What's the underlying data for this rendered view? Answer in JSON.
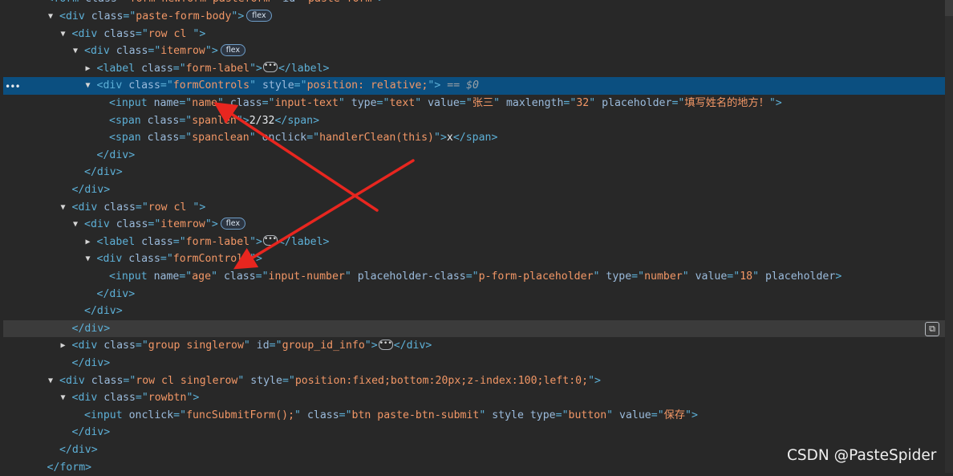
{
  "elements_tree": {
    "lines": [
      {
        "depth": 3,
        "open_tag": "form",
        "attrs": [
          [
            "class",
            "form newform pasteform"
          ],
          [
            "id",
            "paste-form"
          ]
        ],
        "tail": ">",
        "partial": true
      },
      {
        "depth": 4,
        "toggle": "open",
        "open_tag": "div",
        "attrs": [
          [
            "class",
            "paste-form-body"
          ]
        ],
        "tail": ">",
        "badge": "flex"
      },
      {
        "depth": 5,
        "toggle": "open",
        "open_tag": "div",
        "attrs": [
          [
            "class",
            "row cl "
          ]
        ],
        "tail": ">"
      },
      {
        "depth": 6,
        "toggle": "open",
        "open_tag": "div",
        "attrs": [
          [
            "class",
            "itemrow"
          ]
        ],
        "tail": ">",
        "badge": "flex"
      },
      {
        "depth": 7,
        "toggle": "closed",
        "open_tag": "label",
        "attrs": [
          [
            "class",
            "form-label"
          ]
        ],
        "tail": ">",
        "ellipsis": true,
        "close_tag": "label"
      },
      {
        "depth": 7,
        "toggle": "open",
        "open_tag": "div",
        "attrs": [
          [
            "class",
            "formControls"
          ],
          [
            "style",
            "position: relative;"
          ]
        ],
        "tail": ">",
        "selected": true,
        "dollar": " == $0"
      },
      {
        "depth": 8,
        "open_tag": "input",
        "attrs": [
          [
            "name",
            "name"
          ],
          [
            "class",
            "input-text"
          ],
          [
            "type",
            "text"
          ],
          [
            "value",
            "张三"
          ],
          [
            "maxlength",
            "32"
          ],
          [
            "placeholder",
            "填写姓名的地方！"
          ]
        ],
        "tail": ">"
      },
      {
        "depth": 8,
        "open_tag": "span",
        "attrs": [
          [
            "class",
            "spanlen"
          ]
        ],
        "tail": ">",
        "text": "2/32",
        "close_tag": "span"
      },
      {
        "depth": 8,
        "open_tag": "span",
        "attrs": [
          [
            "class",
            "spanclean"
          ],
          [
            "onclick",
            "handlerClean(this)"
          ]
        ],
        "tail": ">",
        "text": "x",
        "close_tag": "span"
      },
      {
        "depth": 7,
        "close_only": "div"
      },
      {
        "depth": 6,
        "close_only": "div"
      },
      {
        "depth": 5,
        "close_only": "div"
      },
      {
        "depth": 5,
        "toggle": "open",
        "open_tag": "div",
        "attrs": [
          [
            "class",
            "row cl "
          ]
        ],
        "tail": ">"
      },
      {
        "depth": 6,
        "toggle": "open",
        "open_tag": "div",
        "attrs": [
          [
            "class",
            "itemrow"
          ]
        ],
        "tail": ">",
        "badge": "flex"
      },
      {
        "depth": 7,
        "toggle": "closed",
        "open_tag": "label",
        "attrs": [
          [
            "class",
            "form-label"
          ]
        ],
        "tail": ">",
        "ellipsis": true,
        "close_tag": "label"
      },
      {
        "depth": 7,
        "toggle": "open",
        "open_tag": "div",
        "attrs": [
          [
            "class",
            "formControls"
          ]
        ],
        "tail": ">"
      },
      {
        "depth": 8,
        "open_tag": "input",
        "attrs": [
          [
            "name",
            "age"
          ],
          [
            "class",
            "input-number"
          ],
          [
            "placeholder-class",
            "p-form-placeholder"
          ],
          [
            "type",
            "number"
          ],
          [
            "value",
            "18"
          ],
          [
            "placeholder",
            null
          ]
        ],
        "tail": ">"
      },
      {
        "depth": 7,
        "close_only": "div"
      },
      {
        "depth": 6,
        "close_only": "div"
      },
      {
        "depth": 5,
        "close_only": "div",
        "hover": true
      },
      {
        "depth": 5,
        "toggle": "closed",
        "open_tag": "div",
        "attrs": [
          [
            "class",
            "group singlerow"
          ],
          [
            "id",
            "group_id_info"
          ]
        ],
        "tail": ">",
        "ellipsis": true,
        "close_tag": "div"
      },
      {
        "depth": 5,
        "close_only": "div"
      },
      {
        "depth": 4,
        "toggle": "open",
        "open_tag": "div",
        "attrs": [
          [
            "class",
            "row cl singlerow"
          ],
          [
            "style",
            "position:fixed;bottom:20px;z-index:100;left:0;"
          ]
        ],
        "tail": ">"
      },
      {
        "depth": 5,
        "toggle": "open",
        "open_tag": "div",
        "attrs": [
          [
            "class",
            "rowbtn"
          ]
        ],
        "tail": ">"
      },
      {
        "depth": 6,
        "open_tag": "input",
        "attrs": [
          [
            "onclick",
            "funcSubmitForm();"
          ],
          [
            "class",
            "btn paste-btn-submit"
          ],
          [
            "style",
            null
          ],
          [
            "type",
            "button"
          ],
          [
            "value",
            "保存"
          ]
        ],
        "tail": ">"
      },
      {
        "depth": 5,
        "close_only": "div"
      },
      {
        "depth": 4,
        "close_only": "div"
      },
      {
        "depth": 3,
        "close_only": "form"
      }
    ]
  },
  "gutter": {
    "dots": "•••"
  },
  "copy_icon": "copy-icon",
  "watermark": "CSDN @PasteSpider",
  "colors": {
    "background": "#282828",
    "selected_row": "#0b4f80",
    "tag": "#5db0d7",
    "attr_name": "#9bbbdc",
    "attr_value": "#f29766",
    "arrow": "#e8261f"
  }
}
